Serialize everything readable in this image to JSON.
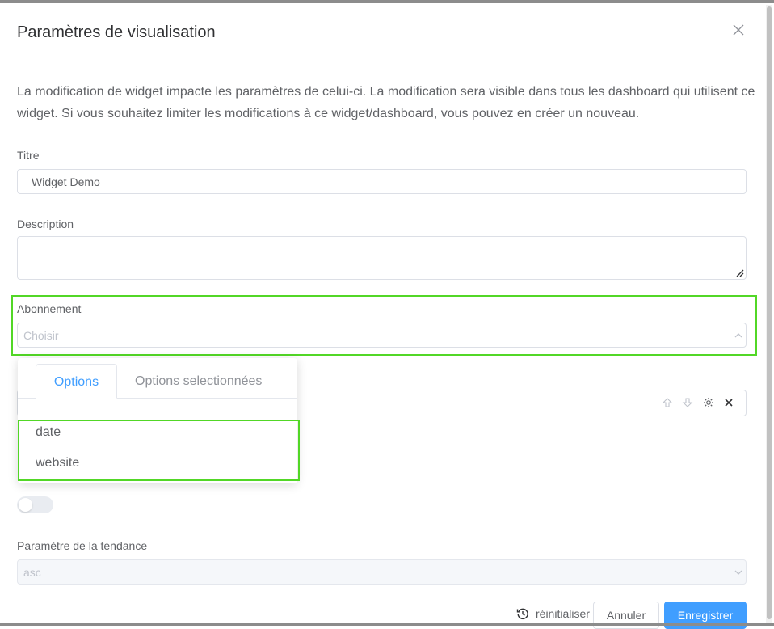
{
  "dialog": {
    "title": "Paramètres de visualisation",
    "intro": "La modification de widget impacte les paramètres de celui-ci. La modification sera visible dans tous les dashboard qui utilisent ce widget. Si vous souhaitez limiter les modifications à ce widget/dashboard, vous pouvez en créer un nouveau."
  },
  "form": {
    "title_label": "Titre",
    "title_value": "Widget Demo",
    "description_label": "Description",
    "description_value": "",
    "subscription_label": "Abonnement",
    "subscription_placeholder": "Choisir",
    "trend_label": "Paramètre de la tendance",
    "trend_value": "asc",
    "toggle_on": false
  },
  "dropdown": {
    "tabs": [
      "Options",
      "Options selectionnées"
    ],
    "active_tab": "Options",
    "options": [
      "date",
      "website"
    ]
  },
  "footer": {
    "reset_label": "réinitialiser",
    "cancel_label": "Annuler",
    "save_label": "Enregistrer"
  },
  "colors": {
    "accent": "#409eff",
    "highlight": "#52d726",
    "text": "#606266"
  },
  "icons": [
    "close-icon",
    "chevron-up-icon",
    "chevron-down-icon",
    "arrow-up-icon",
    "arrow-down-icon",
    "gear-icon",
    "x-icon",
    "history-icon",
    "resize-handle-icon"
  ]
}
